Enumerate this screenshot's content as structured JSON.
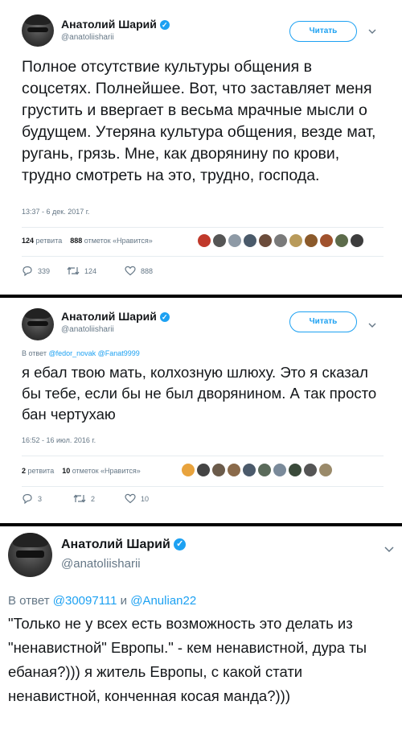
{
  "tweets": [
    {
      "name": "Анатолий Шарий",
      "handle": "@anatoliisharii",
      "follow_label": "Читать",
      "text": "Полное отсутствие культуры общения в соцсетях. Полнейшее. Вот, что заставляет меня грустить и ввергает в весьма мрачные мысли о будущем. Утеряна культура общения, везде мат, ругань, грязь. Мне, как дворянину по крови, трудно смотреть на это, трудно, господа.",
      "time": "13:37 - 6 дек. 2017 г.",
      "retweets_count": "124",
      "retweets_label": "ретвита",
      "likes_count": "888",
      "likes_label": "отметок «Нравится»",
      "reply_count": "339",
      "retweet_count": "124",
      "like_count": "888"
    },
    {
      "name": "Анатолий Шарий",
      "handle": "@anatoliisharii",
      "follow_label": "Читать",
      "reply_prefix": "В ответ",
      "reply_mentions": "@fedor_novak @Fanat9999",
      "text": "я ебал твою мать, колхозную шлюху. Это я сказал бы тебе, если бы не был дворянином. А так просто бан чертухаю",
      "time": "16:52 - 16 июл. 2016 г.",
      "retweets_count": "2",
      "retweets_label": "ретвита",
      "likes_count": "10",
      "likes_label": "отметок «Нравится»",
      "reply_count": "3",
      "retweet_count": "2",
      "like_count": "10"
    },
    {
      "name": "Анатолий Шарий",
      "handle": "@anatoliisharii",
      "reply_prefix": "В ответ",
      "reply_mention_1": "@30097111",
      "reply_and": "и",
      "reply_mention_2": "@Anulian22",
      "text": "\"Только не у всех есть возможность это делать из \"ненавистной\" Европы.\" - кем ненавистной, дура ты ебаная?))) я житель Европы, с какой стати ненавистной, конченная косая манда?)))"
    }
  ],
  "colors": {
    "accent": "#1da1f2",
    "muted": "#657786",
    "text": "#14171a",
    "separator": "#000000"
  }
}
